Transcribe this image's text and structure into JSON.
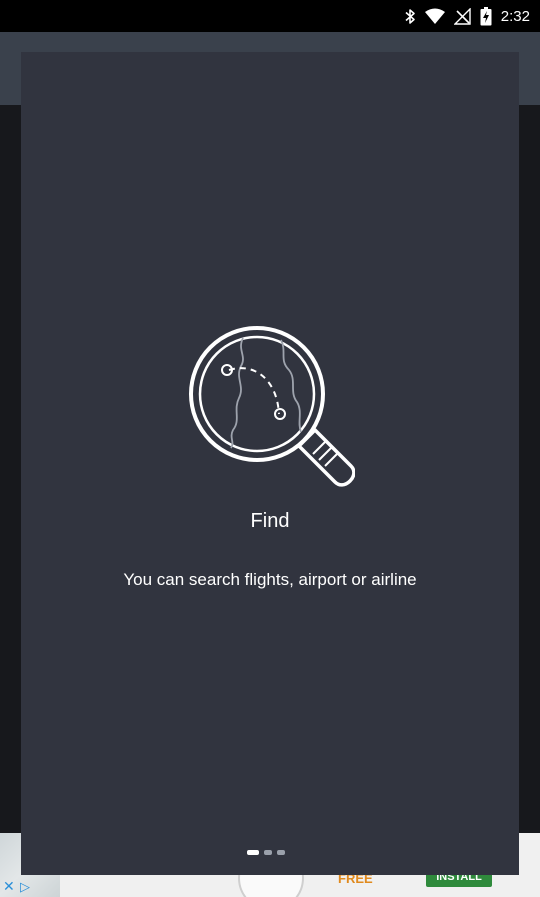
{
  "status_bar": {
    "time": "2:32",
    "icons": [
      "bluetooth-icon",
      "wifi-icon",
      "signal-icon",
      "battery-charging-icon"
    ]
  },
  "onboarding": {
    "illustration_icon": "magnifier-map-icon",
    "title": "Find",
    "subtitle": "You can search flights, airport or airline",
    "page_indicator": {
      "current": 1,
      "total": 3
    }
  },
  "ad_banner": {
    "free_label": "FREE",
    "install_label": "INSTALL"
  },
  "colors": {
    "dialog_background": "#31343f",
    "status_bar": "#000000",
    "text": "#ffffff"
  }
}
